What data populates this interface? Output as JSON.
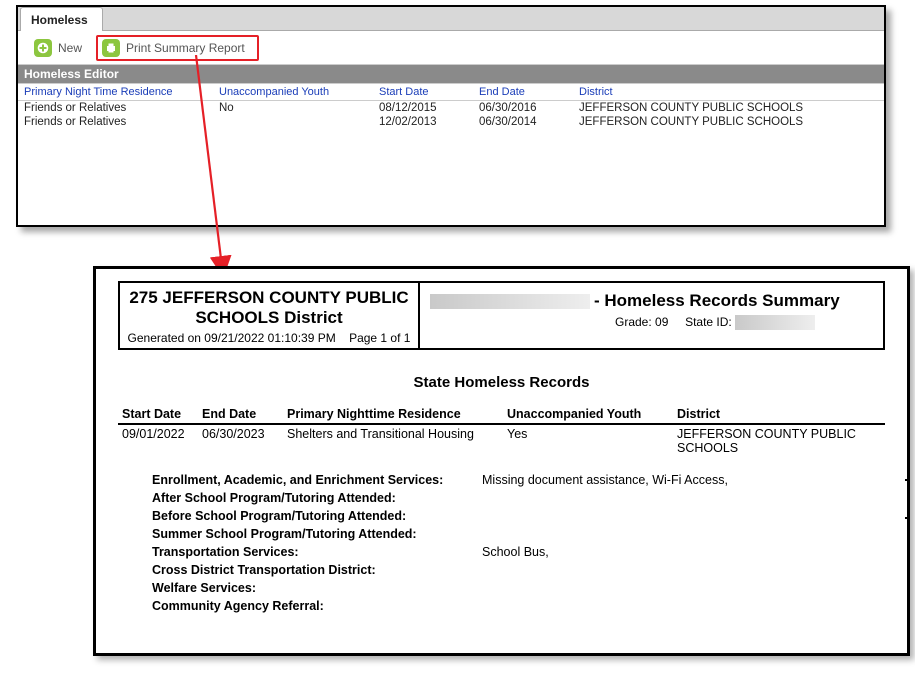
{
  "tab_label": "Homeless",
  "toolbar": {
    "new_label": "New",
    "print_label": "Print Summary Report"
  },
  "editor_title": "Homeless Editor",
  "grid": {
    "headers": {
      "residence": "Primary Night Time Residence",
      "uyouth": "Unaccompanied Youth",
      "start": "Start Date",
      "end": "End Date",
      "district": "District"
    },
    "rows": [
      {
        "residence": "Friends or Relatives",
        "uyouth": "No",
        "start": "08/12/2015",
        "end": "06/30/2016",
        "district": "JEFFERSON COUNTY PUBLIC SCHOOLS"
      },
      {
        "residence": "Friends or Relatives",
        "uyouth": "",
        "start": "12/02/2013",
        "end": "06/30/2014",
        "district": "JEFFERSON COUNTY PUBLIC SCHOOLS"
      }
    ]
  },
  "report": {
    "header": {
      "district_line": "275 JEFFERSON COUNTY PUBLIC SCHOOLS District",
      "generated": "Generated on 09/21/2022 01:10:39 PM",
      "page": "Page 1 of  1",
      "title": "- Homeless Records Summary",
      "grade_label": "Grade:",
      "grade_value": "09",
      "stateid_label": "State ID:"
    },
    "section_title": "State Homeless Records",
    "columns": {
      "start": "Start Date",
      "end": "End Date",
      "residence": "Primary Nighttime Residence",
      "uyouth": "Unaccompanied Youth",
      "district": "District"
    },
    "row": {
      "start": "09/01/2022",
      "end": "06/30/2023",
      "residence": "Shelters and Transitional Housing",
      "uyouth": "Yes",
      "district": "JEFFERSON COUNTY PUBLIC SCHOOLS"
    },
    "services": [
      {
        "label": "Enrollment, Academic, and Enrichment Services:",
        "value": "Missing document assistance, Wi-Fi Access,"
      },
      {
        "label": "After School Program/Tutoring Attended:",
        "value": ""
      },
      {
        "label": "Before School Program/Tutoring Attended:",
        "value": ""
      },
      {
        "label": "Summer School Program/Tutoring Attended:",
        "value": ""
      },
      {
        "label": "Transportation Services:",
        "value": "School Bus,"
      },
      {
        "label": "Cross District Transportation District:",
        "value": ""
      },
      {
        "label": "Welfare Services:",
        "value": ""
      },
      {
        "label": "Community Agency Referral:",
        "value": ""
      }
    ]
  }
}
